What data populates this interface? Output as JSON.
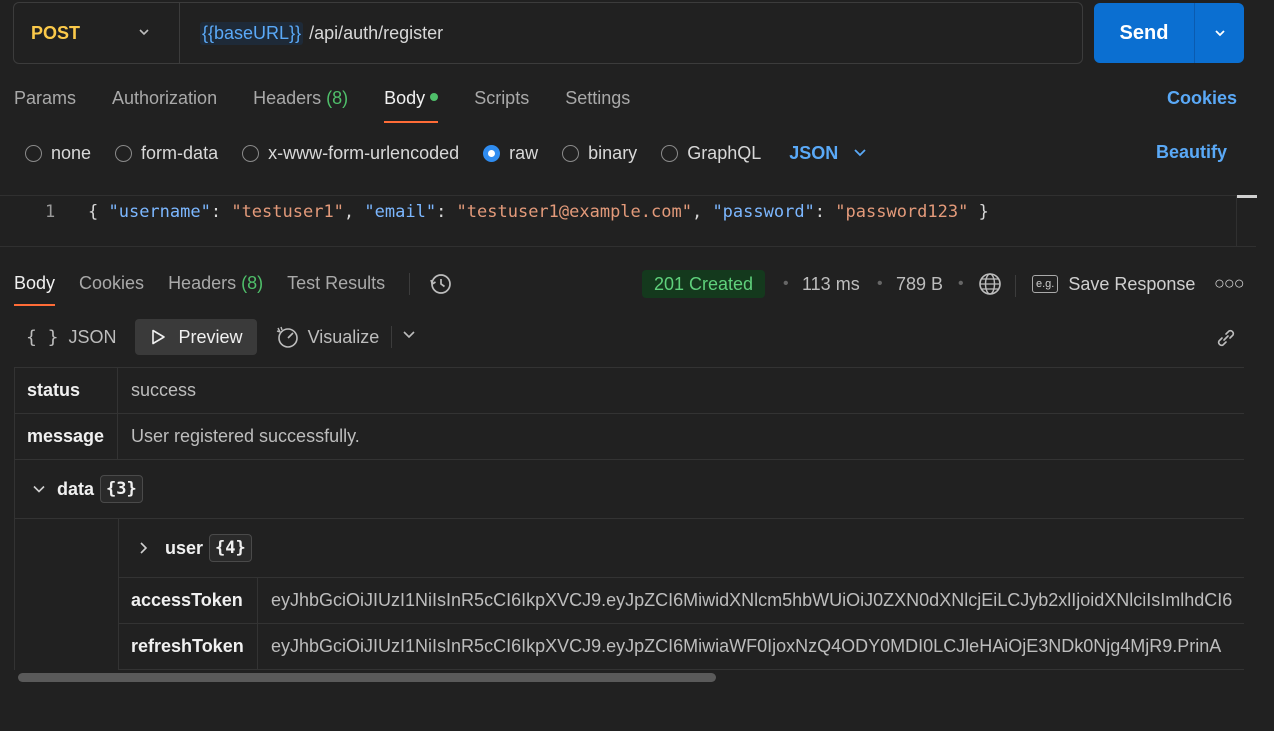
{
  "request": {
    "method": "POST",
    "url_variable": "{{baseURL}}",
    "url_path": "/api/auth/register",
    "send_label": "Send"
  },
  "request_tabs": {
    "params": "Params",
    "authorization": "Authorization",
    "headers": "Headers",
    "headers_count": "(8)",
    "body": "Body",
    "scripts": "Scripts",
    "settings": "Settings",
    "cookies": "Cookies"
  },
  "body_types": {
    "none": "none",
    "form_data": "form-data",
    "urlencoded": "x-www-form-urlencoded",
    "raw": "raw",
    "binary": "binary",
    "graphql": "GraphQL",
    "format": "JSON",
    "beautify": "Beautify",
    "selected": "raw"
  },
  "editor": {
    "line_number": "1",
    "open": "{ ",
    "k1": "\"username\"",
    "v1": "\"testuser1\"",
    "k2": "\"email\"",
    "v2": "\"testuser1@example.com\"",
    "k3": "\"password\"",
    "v3": "\"password123\"",
    "close": " }"
  },
  "response_tabs": {
    "body": "Body",
    "cookies": "Cookies",
    "headers": "Headers",
    "headers_count": "(8)",
    "test_results": "Test Results"
  },
  "response_meta": {
    "status": "201 Created",
    "time": "113 ms",
    "size": "789 B",
    "save_label": "Save Response",
    "eg_label": "e.g."
  },
  "view": {
    "json": "JSON",
    "preview": "Preview",
    "visualize": "Visualize"
  },
  "response_body": {
    "status_key": "status",
    "status_value": "success",
    "message_key": "message",
    "message_value": "User registered successfully.",
    "data_key": "data",
    "data_count": "{3}",
    "user_key": "user",
    "user_count": "{4}",
    "access_key": "accessToken",
    "access_value": "eyJhbGciOiJIUzI1NiIsInR5cCI6IkpXVCJ9.eyJpZCI6MiwidXNlcm5hbWUiOiJ0ZXN0dXNlcjEiLCJyb2xlIjoidXNlciIsImlhdCI6",
    "refresh_key": "refreshToken",
    "refresh_value": "eyJhbGciOiJIUzI1NiIsInR5cCI6IkpXVCJ9.eyJpZCI6MiwiaWF0IjoxNzQ4ODY0MDI0LCJleHAiOjE3NDk0Njg4MjR9.PrinA"
  },
  "colors": {
    "accent_tab": "#ff6c37",
    "send_button": "#0b6fd1",
    "method": "#fbc94a",
    "status_ok": "#5fd07b"
  }
}
